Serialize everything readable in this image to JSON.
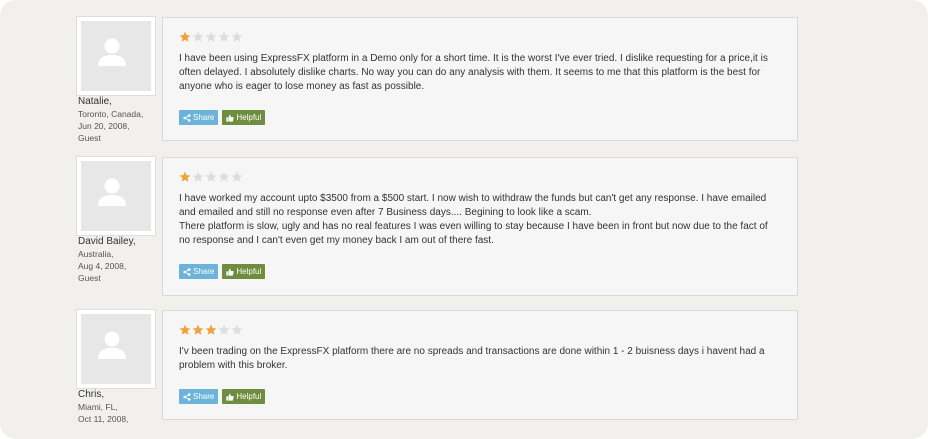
{
  "buttons": {
    "share_label": "Share",
    "helpful_label": "Helpful"
  },
  "colors": {
    "star_filled": "#f0a23b",
    "star_empty": "#dddddd",
    "share_button": "#6bb3d9",
    "helpful_button": "#6f8d3e"
  },
  "reviews": [
    {
      "author": {
        "name": "Natalie,",
        "location": "Toronto, Canada,",
        "date": "Jun 20, 2008,",
        "role": "Guest"
      },
      "rating": 1,
      "max_rating": 5,
      "paragraphs": [
        "I have been using ExpressFX platform in a Demo only for a short time. It is the worst I've ever tried. I dislike requesting for a price,it is often delayed. I absolutely dislike charts. No way you can do any analysis with them. It seems to me that this platform is the best for anyone who is eager to lose money as fast as possible."
      ]
    },
    {
      "author": {
        "name": "David Bailey,",
        "location": "Australia,",
        "date": "Aug 4, 2008,",
        "role": "Guest"
      },
      "rating": 1,
      "max_rating": 5,
      "paragraphs": [
        "I have worked my account upto $3500 from a $500 start. I now wish to withdraw the funds but can't get any response. I have emailed and emailed and still no response even after 7 Business days.... Begining to look like a scam.",
        "There platform is slow, ugly and has no real features I was even willing to stay because I have been in front but now due to the fact of no response and I can't even get my money back I am out of there fast."
      ]
    },
    {
      "author": {
        "name": "Chris,",
        "location": "Miami, FL,",
        "date": "Oct 11, 2008,",
        "role": ""
      },
      "rating": 3,
      "max_rating": 5,
      "paragraphs": [
        "I'v been trading on the ExpressFX platform there are no spreads and transactions are done within 1 - 2 buisness days i havent had a problem with this broker."
      ]
    }
  ]
}
